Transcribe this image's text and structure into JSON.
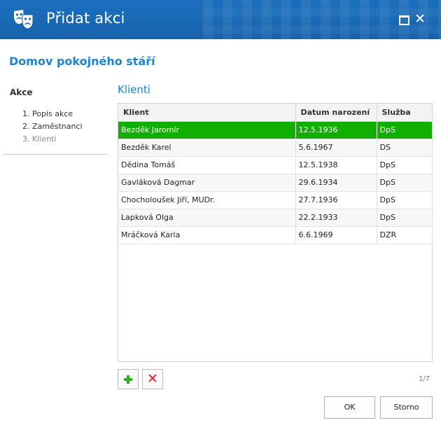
{
  "window": {
    "title": "Přidat akci",
    "icon": "theater-masks-icon",
    "accent_color": "#1a6fbd"
  },
  "organization": "Domov pokojného stáří",
  "sidebar": {
    "heading": "Akce",
    "steps": [
      {
        "label": "1. Popis akce"
      },
      {
        "label": "2. Zaměstnanci"
      },
      {
        "label": "3. Klienti",
        "current": true
      }
    ]
  },
  "section": {
    "title": "Klienti"
  },
  "table": {
    "columns": [
      "Klient",
      "Datum narození",
      "Služba"
    ],
    "rows": [
      {
        "client": "Bezděk Jaromír",
        "dob": "12.5.1936",
        "service": "DpS",
        "selected": true
      },
      {
        "client": "Bezděk Karel",
        "dob": "5.6.1967",
        "service": "DS"
      },
      {
        "client": "Dědina Tomáš",
        "dob": "12.5.1938",
        "service": "DpS"
      },
      {
        "client": "Gavláková Dagmar",
        "dob": "29.6.1934",
        "service": "DpS"
      },
      {
        "client": "Chocholoušek Jiří, MUDr.",
        "dob": "27.7.1936",
        "service": "DpS"
      },
      {
        "client": "Lapková Olga",
        "dob": "22.2.1933",
        "service": "DpS"
      },
      {
        "client": "Mráčková Karla",
        "dob": "6.6.1969",
        "service": "DZR"
      }
    ],
    "selected_color": "#11b000"
  },
  "pager": "1/7",
  "buttons": {
    "ok": "OK",
    "cancel": "Storno"
  }
}
